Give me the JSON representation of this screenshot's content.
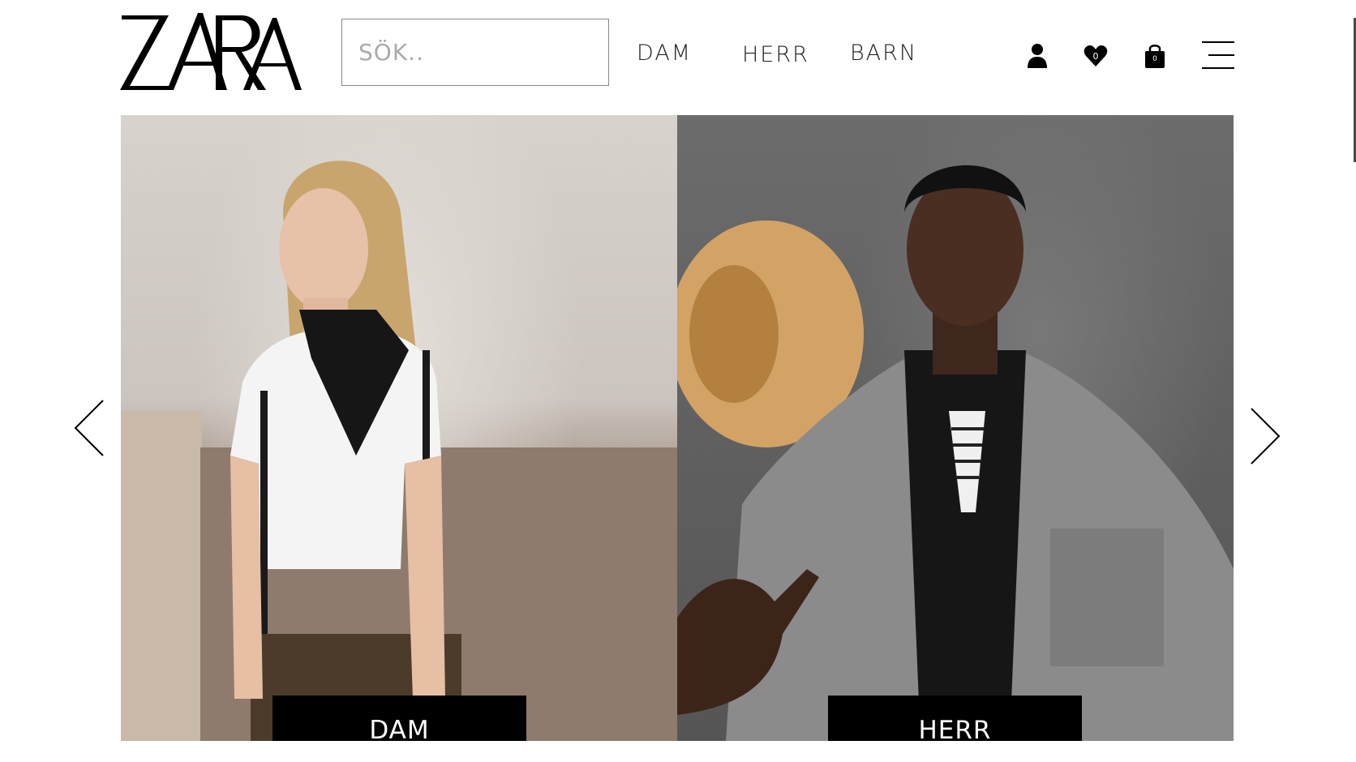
{
  "brand": {
    "logo_text": "ZARA"
  },
  "search": {
    "placeholder": "SÖK.."
  },
  "nav": {
    "links": [
      {
        "label": "DAM"
      },
      {
        "label": "HERR"
      },
      {
        "label": "BARN"
      }
    ]
  },
  "header_icons": {
    "account": "user-icon",
    "wishlist": {
      "icon": "heart-icon",
      "count": "0"
    },
    "cart": {
      "icon": "shopping-bag-icon",
      "count": "0"
    },
    "menu": "hamburger-menu-icon"
  },
  "carousel": {
    "panels": [
      {
        "label": "DAM"
      },
      {
        "label": "HERR"
      }
    ],
    "prev_icon": "chevron-left-icon",
    "next_icon": "chevron-right-icon"
  }
}
